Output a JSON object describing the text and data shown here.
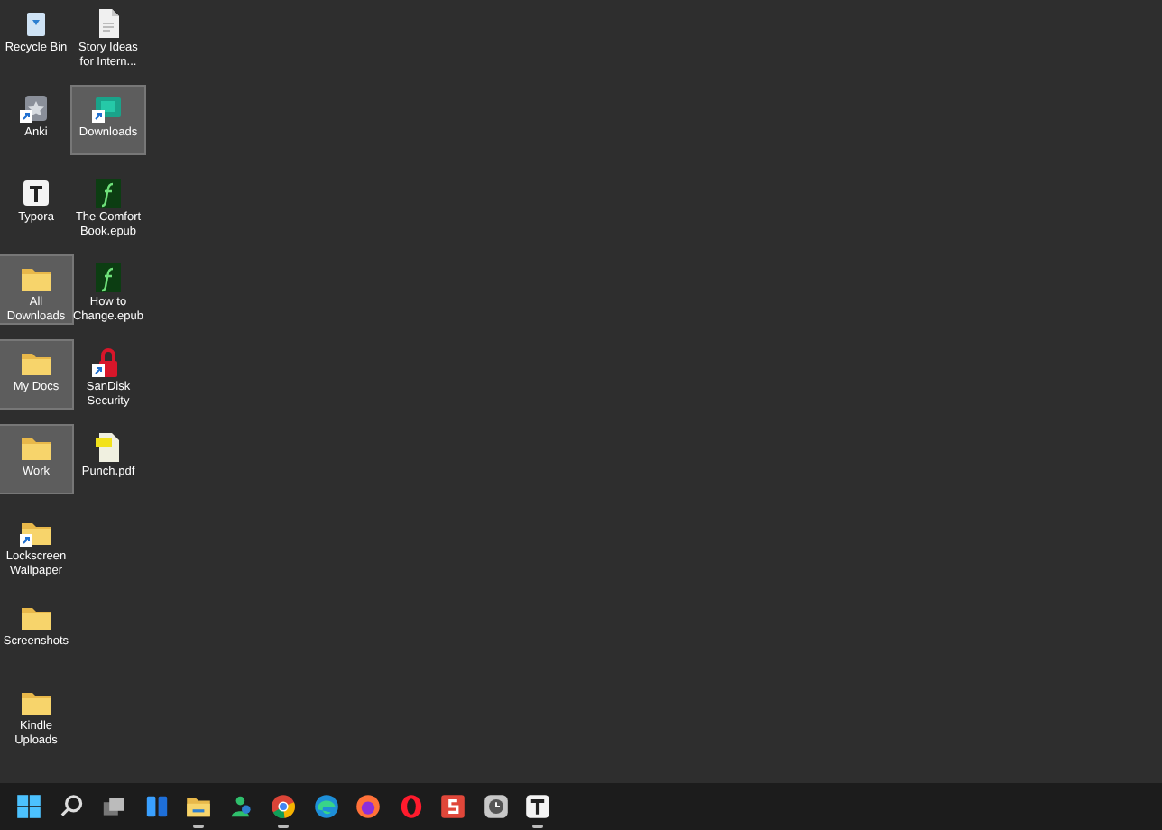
{
  "desktop_icons": [
    {
      "label": "Recycle Bin",
      "kind": "recycle",
      "shortcut": false,
      "selected": false
    },
    {
      "label": "Anki",
      "kind": "anki",
      "shortcut": true,
      "selected": false
    },
    {
      "label": "Typora",
      "kind": "typora",
      "shortcut": false,
      "selected": false
    },
    {
      "label": "All Downloads",
      "kind": "folder",
      "shortcut": false,
      "selected": true
    },
    {
      "label": "My Docs",
      "kind": "folder",
      "shortcut": false,
      "selected": true
    },
    {
      "label": "Work",
      "kind": "folder",
      "shortcut": false,
      "selected": true
    },
    {
      "label": "Lockscreen Wallpaper",
      "kind": "folder",
      "shortcut": true,
      "selected": false
    },
    {
      "label": "Screenshots",
      "kind": "folder",
      "shortcut": false,
      "selected": false
    },
    {
      "label": "Kindle Uploads",
      "kind": "folder",
      "shortcut": false,
      "selected": false
    },
    {
      "label": "Story Ideas for Intern...",
      "kind": "document",
      "shortcut": false,
      "selected": false
    },
    {
      "label": "Downloads",
      "kind": "downloads",
      "shortcut": true,
      "selected": true
    },
    {
      "label": "The Comfort Book.epub",
      "kind": "epub",
      "shortcut": false,
      "selected": false
    },
    {
      "label": "How to Change.epub",
      "kind": "epub",
      "shortcut": false,
      "selected": false
    },
    {
      "label": "SanDisk Security",
      "kind": "lock",
      "shortcut": true,
      "selected": false
    },
    {
      "label": "Punch.pdf",
      "kind": "pdf",
      "shortcut": false,
      "selected": false
    }
  ],
  "taskbar": [
    {
      "kind": "start",
      "running": false
    },
    {
      "kind": "search",
      "running": false
    },
    {
      "kind": "taskview",
      "running": false
    },
    {
      "kind": "widgets",
      "running": false
    },
    {
      "kind": "explorer",
      "running": true
    },
    {
      "kind": "people",
      "running": false
    },
    {
      "kind": "chrome",
      "running": true
    },
    {
      "kind": "edge",
      "running": false
    },
    {
      "kind": "firefox",
      "running": false
    },
    {
      "kind": "opera",
      "running": false
    },
    {
      "kind": "red-s",
      "running": false
    },
    {
      "kind": "clock",
      "running": false
    },
    {
      "kind": "typora",
      "running": true
    }
  ]
}
